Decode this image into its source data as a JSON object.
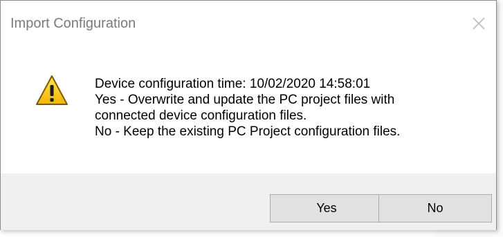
{
  "dialog": {
    "title": "Import Configuration",
    "close_icon": "close-icon",
    "warning_icon": "warning-icon",
    "message_lines": [
      "Device configuration time: 10/02/2020 14:58:01",
      "Yes - Overwrite and update the PC project files with",
      "connected device configuration files.",
      "No - Keep the existing PC Project configuration files."
    ],
    "buttons": {
      "yes_label": "Yes",
      "no_label": "No"
    }
  },
  "colors": {
    "footer_bg": "#f0f0f0",
    "title_text": "#7a7a7a",
    "warning_fill": "#f2c200",
    "warning_border": "#7a5c00",
    "background_accent": "#1f3f8f"
  }
}
